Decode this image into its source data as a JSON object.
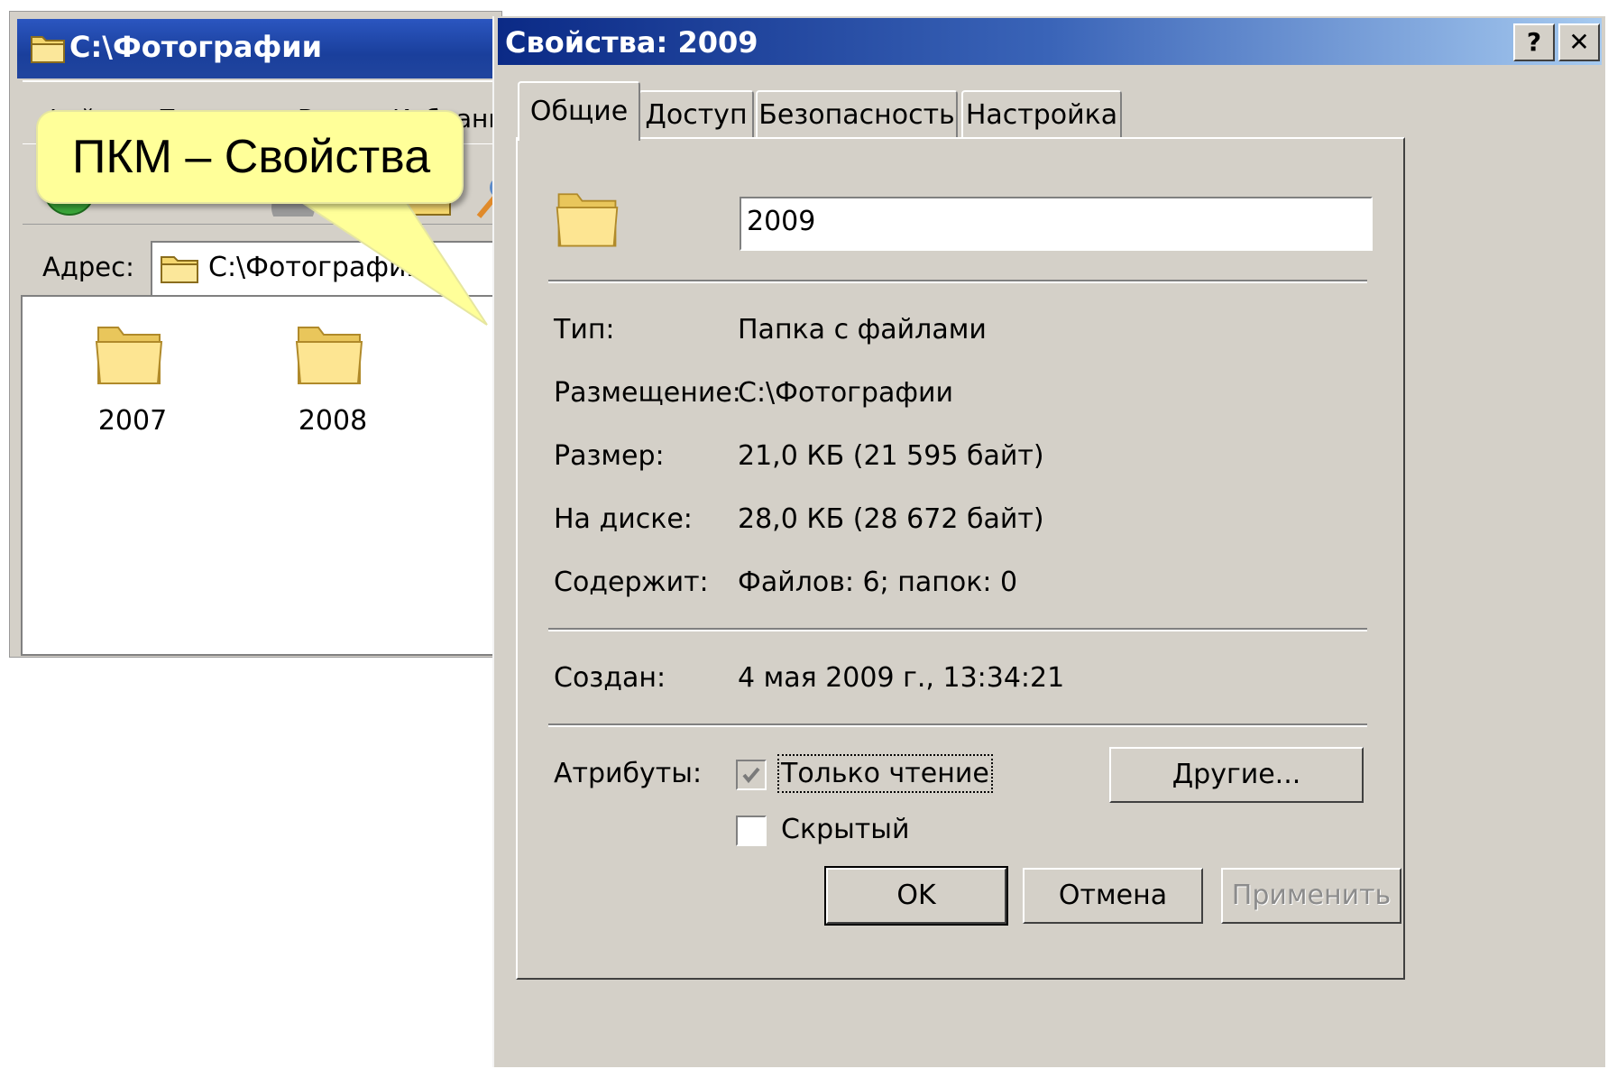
{
  "explorer": {
    "title": "C:\\Фотографии",
    "menu": [
      "Файл",
      "Правка",
      "Вид",
      "Избранное"
    ],
    "address_label": "Адрес:",
    "address_value": "C:\\Фотографии",
    "folders": [
      {
        "name": "2007"
      },
      {
        "name": "2008"
      }
    ]
  },
  "callout": {
    "text": "ПКМ – Свойства"
  },
  "dialog": {
    "title": "Свойства: 2009",
    "help_button": "?",
    "close_button": "✕",
    "tabs": [
      "Общие",
      "Доступ",
      "Безопасность",
      "Настройка"
    ],
    "active_tab": "Общие",
    "folder_name": "2009",
    "properties": {
      "type_label": "Тип:",
      "type_value": "Папка с файлами",
      "location_label": "Размещение:",
      "location_value": "C:\\Фотографии",
      "size_label": "Размер:",
      "size_value": "21,0 КБ (21 595 байт)",
      "disk_label": "На диске:",
      "disk_value": "28,0 КБ (28 672 байт)",
      "contains_label": "Содержит:",
      "contains_value": "Файлов: 6; папок: 0",
      "created_label": "Создан:",
      "created_value": "4 мая 2009 г., 13:34:21"
    },
    "attributes": {
      "label": "Атрибуты:",
      "readonly_label": "Только чтение",
      "readonly_checked": true,
      "hidden_label": "Скрытый",
      "hidden_checked": false,
      "other_button": "Другие..."
    },
    "buttons": {
      "ok": "OK",
      "cancel": "Отмена",
      "apply": "Применить"
    }
  }
}
